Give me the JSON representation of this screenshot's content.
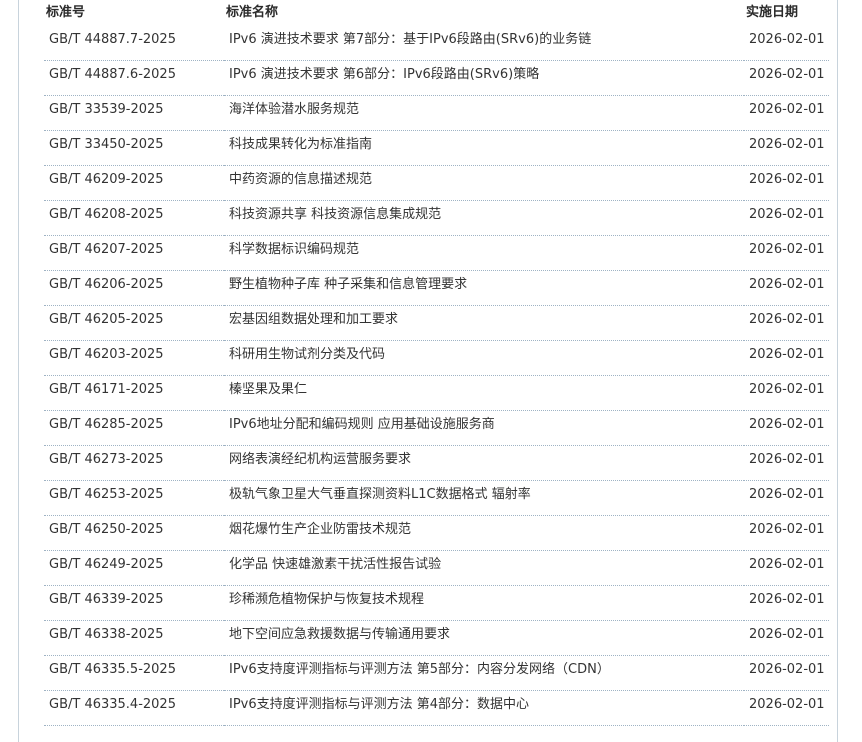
{
  "table": {
    "headers": {
      "code": "标准号",
      "name": "标准名称",
      "date": "实施日期"
    },
    "rows": [
      {
        "code": "GB/T 44887.7-2025",
        "name": "IPv6 演进技术要求 第7部分：基于IPv6段路由(SRv6)的业务链",
        "date": "2026-02-01"
      },
      {
        "code": "GB/T 44887.6-2025",
        "name": "IPv6 演进技术要求 第6部分：IPv6段路由(SRv6)策略",
        "date": "2026-02-01"
      },
      {
        "code": "GB/T 33539-2025",
        "name": "海洋体验潜水服务规范",
        "date": "2026-02-01"
      },
      {
        "code": "GB/T 33450-2025",
        "name": "科技成果转化为标准指南",
        "date": "2026-02-01"
      },
      {
        "code": "GB/T 46209-2025",
        "name": "中药资源的信息描述规范",
        "date": "2026-02-01"
      },
      {
        "code": "GB/T 46208-2025",
        "name": "科技资源共享 科技资源信息集成规范",
        "date": "2026-02-01"
      },
      {
        "code": "GB/T 46207-2025",
        "name": "科学数据标识编码规范",
        "date": "2026-02-01"
      },
      {
        "code": "GB/T 46206-2025",
        "name": "野生植物种子库 种子采集和信息管理要求",
        "date": "2026-02-01"
      },
      {
        "code": "GB/T 46205-2025",
        "name": "宏基因组数据处理和加工要求",
        "date": "2026-02-01"
      },
      {
        "code": "GB/T 46203-2025",
        "name": "科研用生物试剂分类及代码",
        "date": "2026-02-01"
      },
      {
        "code": "GB/T 46171-2025",
        "name": "榛坚果及果仁",
        "date": "2026-02-01"
      },
      {
        "code": "GB/T 46285-2025",
        "name": "IPv6地址分配和编码规则 应用基础设施服务商",
        "date": "2026-02-01"
      },
      {
        "code": "GB/T 46273-2025",
        "name": "网络表演经纪机构运营服务要求",
        "date": "2026-02-01"
      },
      {
        "code": "GB/T 46253-2025",
        "name": "极轨气象卫星大气垂直探测资料L1C数据格式 辐射率",
        "date": "2026-02-01"
      },
      {
        "code": "GB/T 46250-2025",
        "name": "烟花爆竹生产企业防雷技术规范",
        "date": "2026-02-01"
      },
      {
        "code": "GB/T 46249-2025",
        "name": "化学品 快速雄激素干扰活性报告试验",
        "date": "2026-02-01"
      },
      {
        "code": "GB/T 46339-2025",
        "name": "珍稀濒危植物保护与恢复技术规程",
        "date": "2026-02-01"
      },
      {
        "code": "GB/T 46338-2025",
        "name": "地下空间应急救援数据与传输通用要求",
        "date": "2026-02-01"
      },
      {
        "code": "GB/T 46335.5-2025",
        "name": "IPv6支持度评测指标与评测方法 第5部分：内容分发网络（CDN）",
        "date": "2026-02-01"
      },
      {
        "code": "GB/T 46335.4-2025",
        "name": "IPv6支持度评测指标与评测方法 第4部分：数据中心",
        "date": "2026-02-01"
      }
    ]
  },
  "colors": {
    "border": "#c8d3dc",
    "divider": "#9fb3c4",
    "text": "#333333"
  }
}
